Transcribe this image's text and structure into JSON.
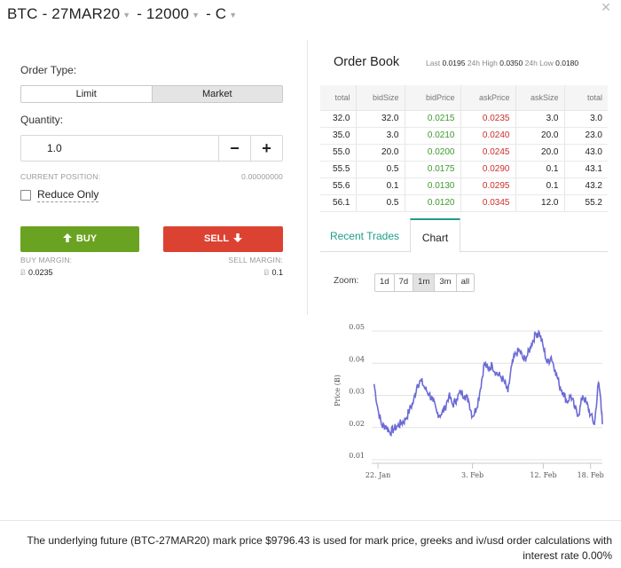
{
  "header": {
    "instrument": "BTC",
    "expiry": "27MAR20",
    "strike": "12000",
    "option_type": "C",
    "separator": "-",
    "close_label": "✕"
  },
  "order_form": {
    "order_type_label": "Order Type:",
    "order_type_options": [
      "Limit",
      "Market"
    ],
    "selected_order_type": "Market",
    "quantity_label": "Quantity:",
    "quantity_value": "1.0",
    "minus_label": "−",
    "plus_label": "+",
    "current_position_label": "CURRENT POSITION:",
    "current_position_value": "0.00000000",
    "reduce_only_label": "Reduce Only",
    "reduce_only_checked": false,
    "buy_label": "BUY",
    "sell_label": "SELL",
    "buy_margin_label": "BUY MARGIN:",
    "sell_margin_label": "SELL MARGIN:",
    "buy_margin_value": "0.0235",
    "sell_margin_value": "0.1",
    "btc_symbol": "Ƀ"
  },
  "order_book": {
    "title": "Order Book",
    "last_label": "Last",
    "last_value": "0.0195",
    "high_label": "24h High",
    "high_value": "0.0350",
    "low_label": "24h Low",
    "low_value": "0.0180",
    "columns": [
      "total",
      "bidSize",
      "bidPrice",
      "askPrice",
      "askSize",
      "total"
    ],
    "rows": [
      [
        "32.0",
        "32.0",
        "0.0215",
        "0.0235",
        "3.0",
        "3.0"
      ],
      [
        "35.0",
        "3.0",
        "0.0210",
        "0.0240",
        "20.0",
        "23.0"
      ],
      [
        "55.0",
        "20.0",
        "0.0200",
        "0.0245",
        "20.0",
        "43.0"
      ],
      [
        "55.5",
        "0.5",
        "0.0175",
        "0.0290",
        "0.1",
        "43.1"
      ],
      [
        "55.6",
        "0.1",
        "0.0130",
        "0.0295",
        "0.1",
        "43.2"
      ],
      [
        "56.1",
        "0.5",
        "0.0120",
        "0.0345",
        "12.0",
        "55.2"
      ]
    ],
    "bid_color": "#3d9b2c",
    "ask_color": "#c9302c"
  },
  "tabs": {
    "items": [
      "Recent Trades",
      "Chart"
    ],
    "active": "Chart",
    "accent_color": "#1f9d87"
  },
  "zoom": {
    "label": "Zoom:",
    "options": [
      "1d",
      "7d",
      "1m",
      "3m",
      "all"
    ],
    "active": "1m"
  },
  "chart_data": {
    "type": "line",
    "ylabel": "Price (Ƀ)",
    "yticks": [
      "0.01",
      "0.02",
      "0.03",
      "0.04",
      "0.05"
    ],
    "ylim": [
      0.01,
      0.05
    ],
    "xticks": [
      "22. Jan",
      "3. Feb",
      "12. Feb",
      "18. Feb"
    ],
    "xtick_days": [
      0,
      12,
      21,
      27
    ],
    "xlim_days": [
      -0.8,
      28.5
    ],
    "line_color": "#6b6bd6",
    "grid": true,
    "series": [
      {
        "x_days": [
          -0.5,
          0,
          0.5,
          1,
          1.5,
          2,
          2.5,
          3,
          3.5,
          4,
          4.5,
          5,
          5.5,
          6,
          6.5,
          7,
          7.5,
          8,
          8.5,
          9,
          9.5,
          10,
          10.5,
          11,
          11.5,
          12,
          12.5,
          13,
          13.5,
          14,
          14.5,
          15,
          15.5,
          16,
          16.5,
          17,
          17.5,
          18,
          18.5,
          19,
          19.5,
          20,
          20.5,
          21,
          21.5,
          22,
          22.5,
          23,
          23.5,
          24,
          24.5,
          25,
          25.5,
          26,
          26.5,
          27,
          27.5,
          28,
          28.3,
          28.5
        ],
        "values": [
          0.0335,
          0.0255,
          0.0205,
          0.0205,
          0.0185,
          0.0195,
          0.0205,
          0.0215,
          0.0225,
          0.0255,
          0.028,
          0.0335,
          0.0345,
          0.032,
          0.0305,
          0.028,
          0.0245,
          0.024,
          0.026,
          0.03,
          0.027,
          0.029,
          0.031,
          0.03,
          0.0285,
          0.0235,
          0.026,
          0.032,
          0.04,
          0.038,
          0.0395,
          0.037,
          0.036,
          0.0345,
          0.031,
          0.0395,
          0.043,
          0.044,
          0.041,
          0.0425,
          0.046,
          0.049,
          0.0495,
          0.045,
          0.04,
          0.042,
          0.038,
          0.0335,
          0.031,
          0.028,
          0.03,
          0.026,
          0.024,
          0.03,
          0.0275,
          0.024,
          0.021,
          0.034,
          0.029,
          0.021
        ]
      }
    ]
  },
  "footer": {
    "text": "The underlying future (BTC-27MAR20) mark price $9796.43 is used for mark price, greeks and iv/usd order calculations with interest rate 0.00%"
  }
}
